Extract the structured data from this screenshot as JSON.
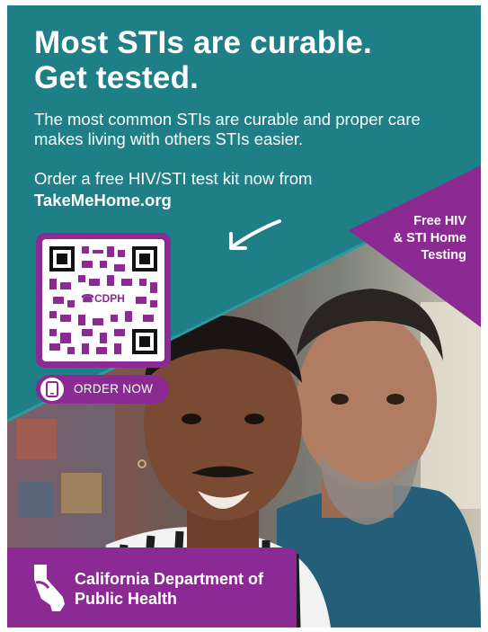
{
  "headline": {
    "line1": "Most STIs are curable.",
    "line2": "Get tested."
  },
  "subtext": "The most common STIs are curable and proper care makes living with others STIs easier.",
  "order": {
    "text": "Order a free HIV/STI test kit now from",
    "url": "TakeMeHome.org"
  },
  "tag": {
    "line1": "Free HIV",
    "line2": "& STI Home",
    "line3": "Testing"
  },
  "qr": {
    "label": "☎CDPH"
  },
  "order_button": {
    "label": "ORDER NOW"
  },
  "agency": {
    "line1": "California Department of",
    "line2": "Public Health"
  },
  "colors": {
    "teal": "#1f7f86",
    "purple": "#8c2a93",
    "white": "#ffffff"
  }
}
